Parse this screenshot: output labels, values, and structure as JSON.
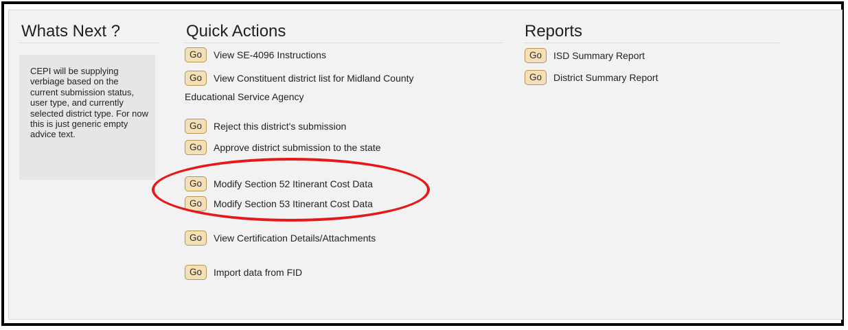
{
  "whats_next": {
    "title": "Whats Next ?",
    "advice": "CEPI will be supplying verbiage based on the current submission status, user type, and currently selected district type. For now this is just generic empty advice text."
  },
  "quick_actions": {
    "title": "Quick Actions",
    "go_label": "Go",
    "items": [
      {
        "label": "View SE-4096 Instructions"
      },
      {
        "label": "View Constituent district list for Midland County",
        "continuation": "Educational Service Agency"
      },
      {
        "label": "Reject this district's submission"
      },
      {
        "label": "Approve district submission to the state"
      },
      {
        "label": "Modify Section 52 Itinerant Cost Data"
      },
      {
        "label": "Modify Section 53 Itinerant Cost Data"
      },
      {
        "label": "View Certification Details/Attachments"
      },
      {
        "label": "Import data from FID"
      }
    ]
  },
  "reports": {
    "title": "Reports",
    "go_label": "Go",
    "items": [
      {
        "label": "ISD Summary Report"
      },
      {
        "label": "District Summary Report"
      }
    ]
  },
  "annotation": {
    "color": "#e41a1a",
    "highlight": "red-ellipse"
  }
}
